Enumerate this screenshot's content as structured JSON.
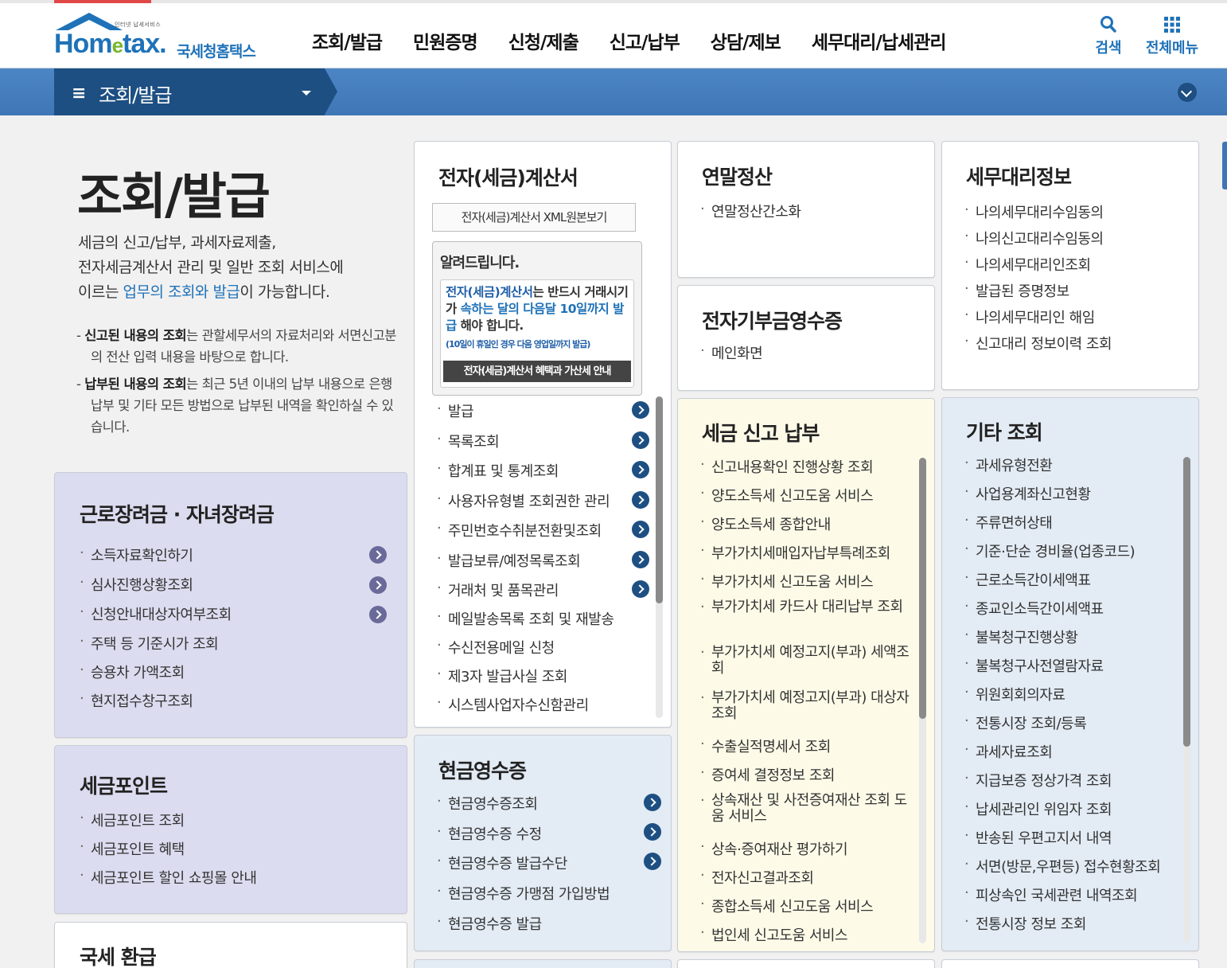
{
  "header": {
    "logo_tagline": "인터넷 납세서비스",
    "logo_word_a": "Hom",
    "logo_word_e": "e",
    "logo_word_b": "tax.",
    "logo_subname": "국세청홈택스",
    "nav": [
      "조회/발급",
      "민원증명",
      "신청/제출",
      "신고/납부",
      "상담/제보",
      "세무대리/납세관리"
    ],
    "search_label": "검색",
    "menu_label": "전체메뉴"
  },
  "subbar": {
    "hamburger": "≡",
    "title": "조회/발급"
  },
  "left": {
    "page_title": "조회/발급",
    "intro_1": "세금의 신고/납부, 과세자료제출,",
    "intro_2": "전자세금계산서 관리 및 일반 조회 서비스에",
    "intro_3a": "이르는 ",
    "intro_3b": "업무의 조회와 발급",
    "intro_3c": "이 가능합니다.",
    "note1_bold": "신고된 내용의 조회",
    "note1_rest": "는 관할세무서의 자료처리와 서면신고분의 전산 입력 내용을 바탕으로 합니다.",
    "note2_bold": "납부된 내용의 조회",
    "note2_rest": "는 최근 5년 이내의 납부 내용으로 은행 납부 및 기타 모든 방법으로 납부된 내역을 확인하실 수 있습니다."
  },
  "boxes": {
    "labor": {
      "title": "근로장려금 · 자녀장려금",
      "items": [
        "소득자료확인하기",
        "심사진행상황조회",
        "신청안내대상자여부조회",
        "주택 등 기준시가 조회",
        "승용차 가액조회",
        "현지접수창구조회"
      ]
    },
    "point": {
      "title": "세금포인트",
      "items": [
        "세금포인트 조회",
        "세금포인트 혜택",
        "세금포인트 할인 쇼핑몰 안내"
      ]
    },
    "refund": {
      "title": "국세 환급"
    },
    "einvoice": {
      "title": "전자(세금)계산서",
      "xml_button": "전자(세금)계산서 XML원본보기",
      "notice_title": "알려드립니다.",
      "notice_a": "전자(세금)계산서",
      "notice_b": "는 반드시 거래시기가 ",
      "notice_c": "속하는 달의 다음달 10일까지 발급",
      "notice_d": " 해야 합니다.",
      "notice_small": "(10일이 휴일인 경우 다음 영업일까지 발급)",
      "notice_button": "전자(세금)계산서 혜택과 가산세 안내",
      "items": [
        "발급",
        "목록조회",
        "합계표 및 통계조회",
        "사용자유형별 조회권한 관리",
        "주민번호수취분전환및조회",
        "발급보류/예정목록조회",
        "거래처 및 품목관리",
        "메일발송목록 조회 및 재발송",
        "수신전용메일 신청",
        "제3자 발급사실 조회",
        "시스템사업자수신함관리"
      ]
    },
    "cash": {
      "title": "현금영수증",
      "items": [
        "현금영수증조회",
        "현금영수증 수정",
        "현금영수증 발급수단",
        "현금영수증 가맹점 가입방법",
        "현금영수증 발급"
      ]
    },
    "yearend": {
      "title": "연말정산",
      "items": [
        "연말정산간소화"
      ]
    },
    "donation": {
      "title": "전자기부금영수증",
      "items": [
        "메인화면"
      ]
    },
    "taxreport": {
      "title": "세금 신고 납부",
      "items": [
        "신고내용확인 진행상황 조회",
        "양도소득세 신고도움 서비스",
        "양도소득세 종합안내",
        "부가가치세매입자납부특례조회",
        "부가가치세 신고도움 서비스",
        "부가가치세 카드사 대리납부 조회",
        "부가가치세 예정고지(부과) 세액조회",
        "부가가치세 예정고지(부과) 대상자 조회",
        "수출실적명세서 조회",
        "증여세 결정정보 조회",
        "상속재산 및 사전증여재산 조회 도움 서비스",
        "상속·증여재산 평가하기",
        "전자신고결과조회",
        "종합소득세 신고도움 서비스",
        "법인세 신고도움 서비스"
      ]
    },
    "agent": {
      "title": "세무대리정보",
      "items": [
        "나의세무대리수임동의",
        "나의신고대리수임동의",
        "나의세무대리인조회",
        "발급된 증명정보",
        "나의세무대리인 해임",
        "신고대리 정보이력 조회"
      ]
    },
    "etc": {
      "title": "기타 조회",
      "items": [
        "과세유형전환",
        "사업용계좌신고현황",
        "주류면허상태",
        "기준·단순 경비율(업종코드)",
        "근로소득간이세액표",
        "종교인소득간이세액표",
        "불복청구진행상황",
        "불복청구사전열람자료",
        "위원회회의자료",
        "전통시장 조회/등록",
        "과세자료조회",
        "지급보증 정상가격 조회",
        "납세관리인 위임자 조회",
        "반송된 우편고지서 내역",
        "서면(방문,우편등) 접수현황조회",
        "피상속인 국세관련 내역조회",
        "전통시장 정보 조회"
      ]
    }
  },
  "colors": {
    "brand_blue": "#1f72b8",
    "nav_dark": "#1d4f82",
    "logo_green": "#78b52c"
  }
}
